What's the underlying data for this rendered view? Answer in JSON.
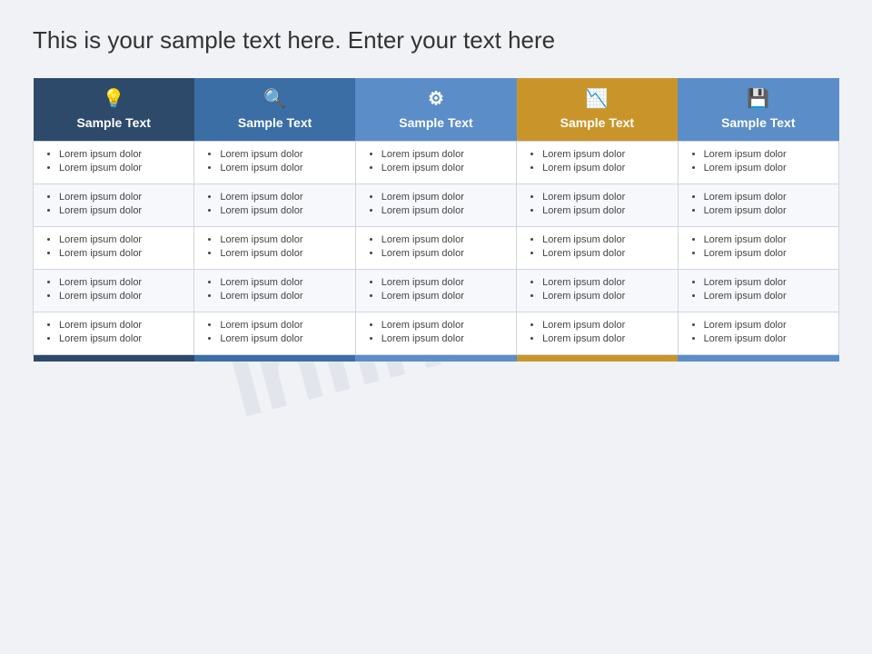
{
  "page": {
    "title": "This is your sample text here. Enter your text here",
    "watermark": "infinitum"
  },
  "columns": [
    {
      "id": "col1",
      "icon": "💡",
      "icon_name": "lightbulb-icon",
      "header": "Sample Text",
      "color_class": "col-1-header",
      "bottom_class": "bottom-bar-1"
    },
    {
      "id": "col2",
      "icon": "🔍",
      "icon_name": "search-icon",
      "header": "Sample Text",
      "color_class": "col-2-header",
      "bottom_class": "bottom-bar-2"
    },
    {
      "id": "col3",
      "icon": "⚙",
      "icon_name": "gear-icon",
      "header": "Sample Text",
      "color_class": "col-3-header",
      "bottom_class": "bottom-bar-3"
    },
    {
      "id": "col4",
      "icon": "📉",
      "icon_name": "chart-icon",
      "header": "Sample Text",
      "color_class": "col-4-header",
      "bottom_class": "bottom-bar-4"
    },
    {
      "id": "col5",
      "icon": "💾",
      "icon_name": "database-icon",
      "header": "Sample Text",
      "color_class": "col-5-header",
      "bottom_class": "bottom-bar-5"
    }
  ],
  "rows": [
    {
      "cells": [
        [
          "Lorem ipsum dolor",
          "Lorem ipsum dolor"
        ],
        [
          "Lorem ipsum dolor",
          "Lorem ipsum dolor"
        ],
        [
          "Lorem ipsum dolor",
          "Lorem ipsum dolor"
        ],
        [
          "Lorem ipsum dolor",
          "Lorem ipsum dolor"
        ],
        [
          "Lorem ipsum dolor",
          "Lorem ipsum dolor"
        ]
      ]
    },
    {
      "cells": [
        [
          "Lorem ipsum dolor",
          "Lorem ipsum dolor"
        ],
        [
          "Lorem ipsum dolor",
          "Lorem ipsum dolor"
        ],
        [
          "Lorem ipsum dolor",
          "Lorem ipsum dolor"
        ],
        [
          "Lorem ipsum dolor",
          "Lorem ipsum dolor"
        ],
        [
          "Lorem ipsum dolor",
          "Lorem ipsum dolor"
        ]
      ]
    },
    {
      "cells": [
        [
          "Lorem ipsum dolor",
          "Lorem ipsum dolor"
        ],
        [
          "Lorem ipsum dolor",
          "Lorem ipsum dolor"
        ],
        [
          "Lorem ipsum dolor",
          "Lorem ipsum dolor"
        ],
        [
          "Lorem ipsum dolor",
          "Lorem ipsum dolor"
        ],
        [
          "Lorem ipsum dolor",
          "Lorem ipsum dolor"
        ]
      ]
    },
    {
      "cells": [
        [
          "Lorem ipsum dolor",
          "Lorem ipsum dolor"
        ],
        [
          "Lorem ipsum dolor",
          "Lorem ipsum dolor"
        ],
        [
          "Lorem ipsum dolor",
          "Lorem ipsum dolor"
        ],
        [
          "Lorem ipsum dolor",
          "Lorem ipsum dolor"
        ],
        [
          "Lorem ipsum dolor",
          "Lorem ipsum dolor"
        ]
      ]
    },
    {
      "cells": [
        [
          "Lorem ipsum dolor",
          "Lorem ipsum dolor"
        ],
        [
          "Lorem ipsum dolor",
          "Lorem ipsum dolor"
        ],
        [
          "Lorem ipsum dolor",
          "Lorem ipsum dolor"
        ],
        [
          "Lorem ipsum dolor",
          "Lorem ipsum dolor"
        ],
        [
          "Lorem ipsum dolor",
          "Lorem ipsum dolor"
        ]
      ]
    }
  ]
}
